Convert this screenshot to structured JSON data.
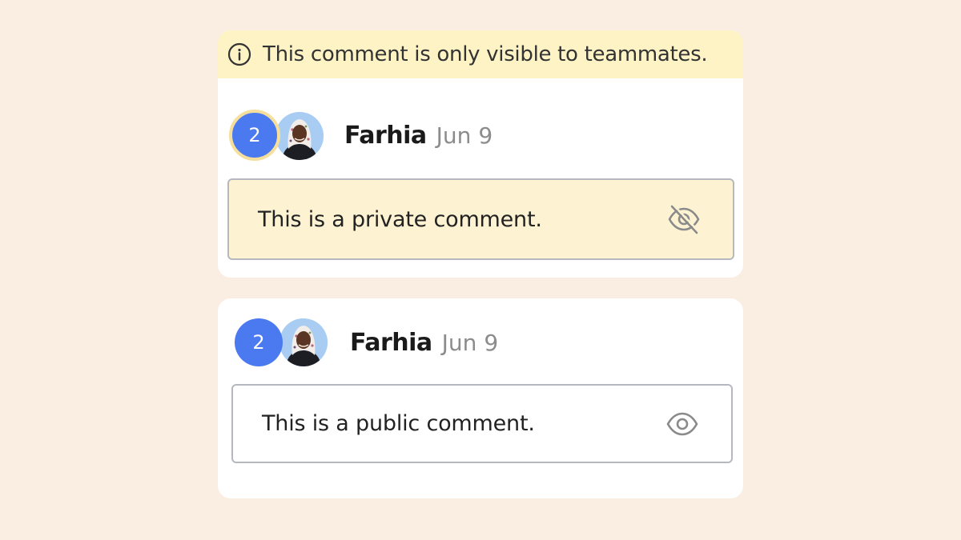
{
  "private_card": {
    "banner_text": "This comment is only visible to teammates.",
    "banner_icon": "info-icon",
    "participant_count": "2",
    "author": "Farhia",
    "date": "Jun 9",
    "comment": "This is a private comment.",
    "visibility_icon": "eye-off-icon"
  },
  "public_card": {
    "participant_count": "2",
    "author": "Farhia",
    "date": "Jun 9",
    "comment": "This is a public comment.",
    "visibility_icon": "eye-icon"
  },
  "colors": {
    "background": "#faede1",
    "banner": "#fdf3c4",
    "private_comment_fill": "#fdf3d2",
    "badge": "#4b79f0",
    "badge_ring": "#f6df9c",
    "muted_text": "#8c8c8c"
  }
}
